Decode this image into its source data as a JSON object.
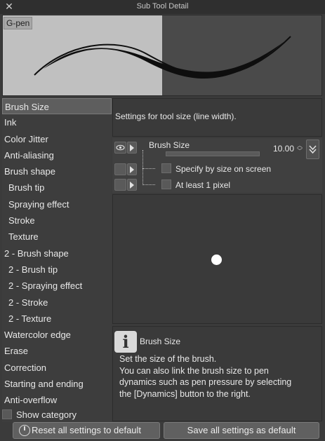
{
  "window": {
    "title": "Sub Tool Detail"
  },
  "preview": {
    "tool_name": "G-pen"
  },
  "sidebar": {
    "items": [
      {
        "label": "Brush Size"
      },
      {
        "label": "Ink"
      },
      {
        "label": "Color Jitter"
      },
      {
        "label": "Anti-aliasing"
      },
      {
        "label": "Brush shape"
      },
      {
        "label": "Brush tip"
      },
      {
        "label": "Spraying effect"
      },
      {
        "label": "Stroke"
      },
      {
        "label": "Texture"
      },
      {
        "label": "2 - Brush shape"
      },
      {
        "label": "2 - Brush tip"
      },
      {
        "label": "2 - Spraying effect"
      },
      {
        "label": "2 - Stroke"
      },
      {
        "label": "2 - Texture"
      },
      {
        "label": "Watercolor edge"
      },
      {
        "label": "Erase"
      },
      {
        "label": "Correction"
      },
      {
        "label": "Starting and ending"
      },
      {
        "label": "Anti-overflow"
      }
    ],
    "selected": "Brush Size",
    "show_category_label": "Show category"
  },
  "panel": {
    "description": "Settings for tool size (line width).",
    "brush_size_label": "Brush Size",
    "brush_size_value": "10.00",
    "specify_by_screen_label": "Specify by size on screen",
    "at_least_one_pixel_label": "At least 1 pixel"
  },
  "help": {
    "title": "Brush Size",
    "lines": [
      "Set the size of the brush.",
      "You can also link the brush size to pen",
      "dynamics such as pen pressure by selecting",
      "the [Dynamics] button to the right."
    ]
  },
  "footer": {
    "reset_label": "Reset all settings to default",
    "save_label": "Save all settings as default"
  }
}
